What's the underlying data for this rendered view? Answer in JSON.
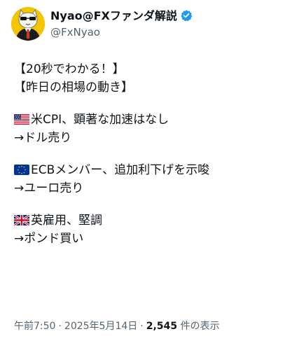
{
  "author": {
    "display_name": "Nyao@FXファンダ解説",
    "handle": "@FxNyao",
    "avatar_icon": "cat-avatar-icon",
    "verified_icon": "verified-badge-icon",
    "verified_color": "#1d9bf0"
  },
  "post": {
    "lines": {
      "l1": "【20秒でわかる！】",
      "l2": "【昨日の相場の動き】",
      "l3": "米CPI、顕著な加速はなし",
      "l4": "→ドル売り",
      "l5": "ECBメンバー、追加利下げを示唆",
      "l6": "→ユーロ売り",
      "l7": "英雇用、堅調",
      "l8": "→ポンド買い"
    },
    "flags": {
      "us": "us-flag-icon",
      "eu": "eu-flag-icon",
      "uk": "uk-flag-icon"
    }
  },
  "meta": {
    "time": "午前7:50",
    "separator": "·",
    "date": "2025年5月14日",
    "views_count": "2,545",
    "views_label": " 件の表示"
  }
}
